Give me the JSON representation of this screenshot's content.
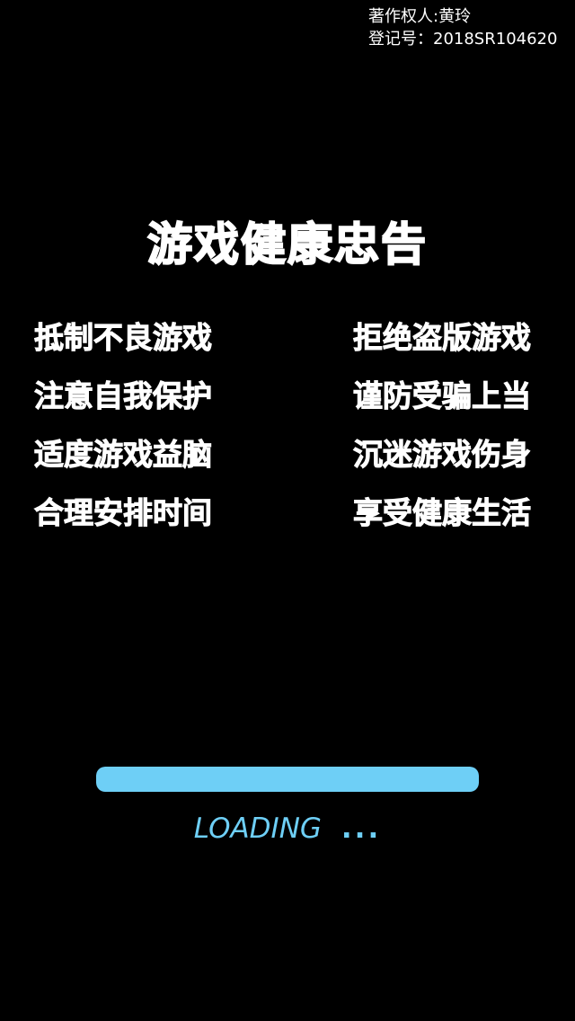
{
  "copyright": {
    "owner": "著作权人:黄玲",
    "registration": "登记号：2018SR104620"
  },
  "title": "游戏健康忠告",
  "advice": {
    "left": [
      "抵制不良游戏",
      "注意自我保护",
      "适度游戏益脑",
      "合理安排时间"
    ],
    "right": [
      "拒绝盗版游戏",
      "谨防受骗上当",
      "沉迷游戏伤身",
      "享受健康生活"
    ]
  },
  "loading": {
    "label": "LOADING",
    "dots": "...",
    "progress": 1.0
  },
  "colors": {
    "background": "#000000",
    "text": "#ffffff",
    "accent": "#6ecff6"
  }
}
